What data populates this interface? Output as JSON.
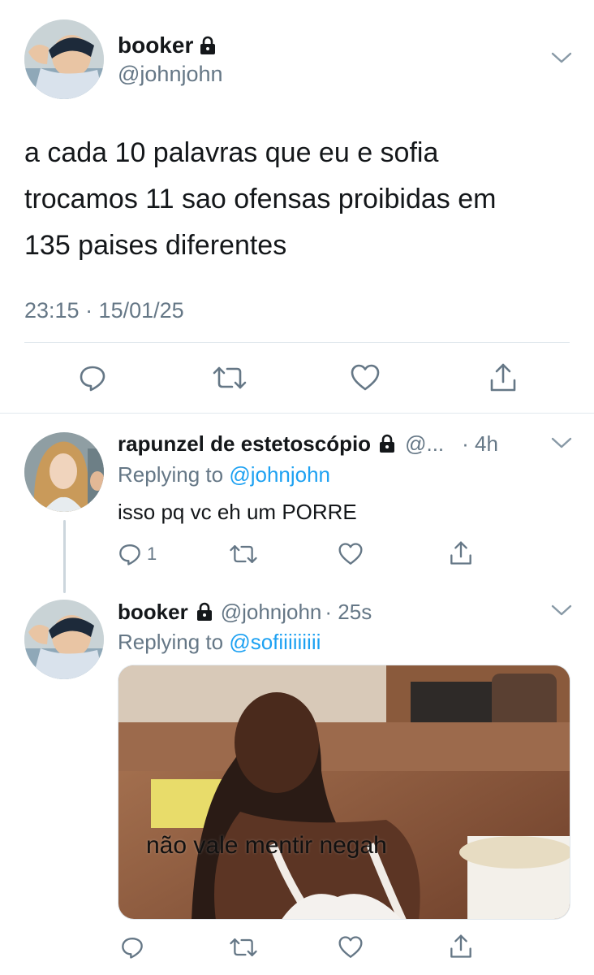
{
  "main_tweet": {
    "author_name": "booker",
    "author_handle": "@johnjohn",
    "text_lines": [
      "a cada 10 palavras que eu e sofia",
      "trocamos 11 sao ofensas proibidas em",
      "135 paises diferentes"
    ],
    "timestamp": "23:15 · 15/01/25",
    "avatar_icon": "avatar-photo",
    "locked_icon": "lock-icon",
    "more_icon": "chevron-down-icon"
  },
  "reply_1": {
    "author_name": "rapunzel de estetoscópio",
    "author_handle": "@...",
    "time": "· 4h",
    "replying_prefix": "Replying to",
    "replying_to": "@johnjohn",
    "text": "isso pq vc eh um PORRE",
    "reply_count": "1"
  },
  "reply_2": {
    "author_name": "booker",
    "author_handle": "@johnjohn",
    "time": "· 25s",
    "replying_prefix": "Replying to",
    "replying_to": "@sofiiiiiiiii",
    "media_caption": "não vale mentir negah"
  },
  "colors": {
    "link": "#1da1f2",
    "muted": "#657786",
    "text": "#14171a",
    "divider": "#e1e8ed",
    "thread": "#ccd6dd"
  }
}
